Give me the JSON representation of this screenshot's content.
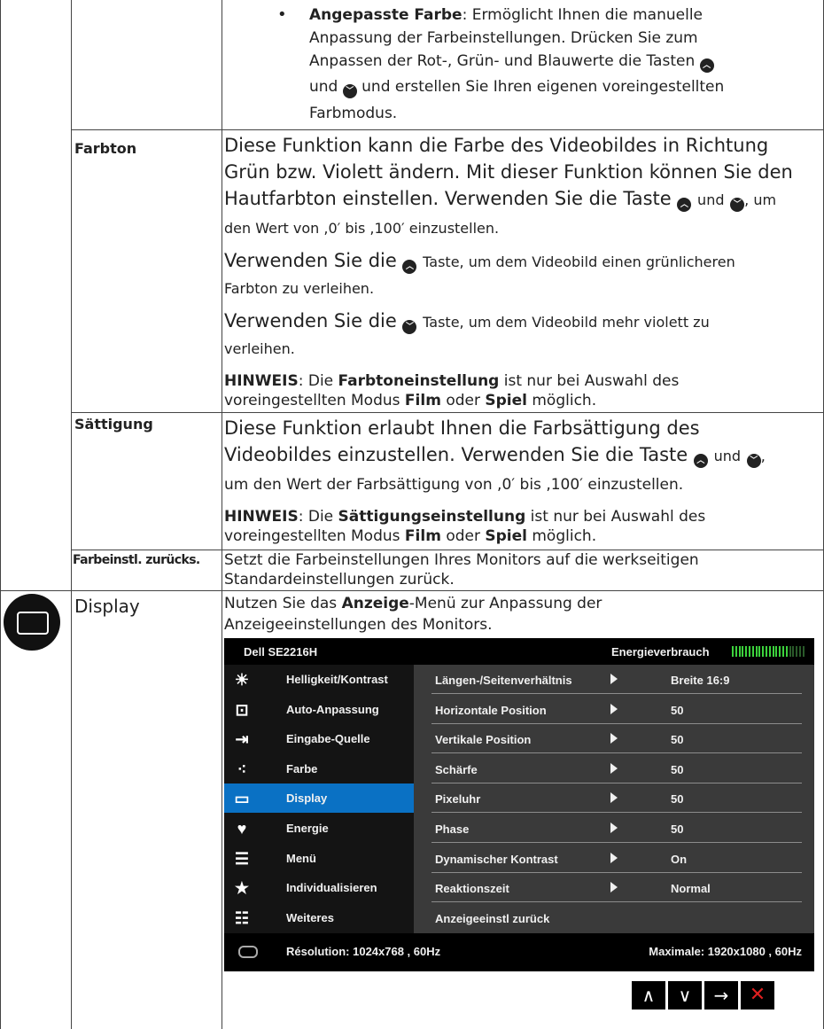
{
  "rows": {
    "row1": {
      "bullet_title": "Angepasste Farbe",
      "bullet_text_1": ": Ermöglicht Ihnen die manuelle",
      "bullet_text_2": "Anpassung der Farbeinstellungen. Drücken Sie zum",
      "bullet_text_3": "Anpassen der Rot-, Grün- und Blauwerte die Tasten",
      "bullet_text_4a": "und",
      "bullet_text_4b": "und erstellen Sie Ihren eigenen voreingestellten",
      "bullet_text_5": "Farbmodus."
    },
    "farbton": {
      "label": "Farbton",
      "p1_l1": "Diese Funktion kann die Farbe des Videobildes in Richtung",
      "p1_l2": "Grün bzw. Violett ändern. Mit dieser Funktion können Sie den",
      "p1_l3a": "Hautfarbton einstellen. Verwenden Sie die Taste",
      "p1_l3b": "und",
      "p1_l3c": ", um",
      "p1_l4": "den Wert von ,0′ bis ,100′ einzustellen.",
      "p2_l1a": "Verwenden Sie die",
      "p2_l1b": "Taste, um dem Videobild einen grünlicheren",
      "p2_l2": "Farbton zu verleihen.",
      "p3_l1a": "Verwenden Sie die",
      "p3_l1b": "Taste, um dem Videobild mehr violett zu",
      "p3_l2": "verleihen.",
      "note_head": "HINWEIS",
      "note_a": ": Die",
      "note_b": "Farbtoneinstellung",
      "note_c": "ist nur bei Auswahl des",
      "note_d": "voreingestellten Modus",
      "note_e": "Film",
      "note_f": "oder",
      "note_g": "Spiel",
      "note_h": "möglich."
    },
    "saettigung": {
      "label": "Sättigung",
      "p1_l1": "Diese Funktion erlaubt Ihnen die Farbsättigung des",
      "p1_l2a": "Videobildes einzustellen. Verwenden Sie die Taste",
      "p1_l2b": "und",
      "p1_l2c": ",",
      "p1_l3": "um den Wert der Farbsättigung von ,0′ bis ,100′ einzustellen.",
      "note_head": "HINWEIS",
      "note_a": ": Die",
      "note_b": "Sättigungseinstellung",
      "note_c": "ist nur bei Auswahl des",
      "note_d": "voreingestellten Modus",
      "note_e": "Film",
      "note_f": "oder",
      "note_g": "Spiel",
      "note_h": "möglich."
    },
    "reset": {
      "label": "Farbeinstl. zurücks.",
      "l1": "Setzt die Farbeinstellungen Ihres Monitors auf die werkseitigen",
      "l2": "Standardeinstellungen zurück."
    },
    "display": {
      "label": "Display",
      "l1a": "Nutzen Sie das",
      "l1b": "Anzeige",
      "l1c": "-Menü zur Anpassung der",
      "l2": "Anzeigeeinstellungen des Monitors."
    }
  },
  "osd": {
    "model": "Dell SE2216H",
    "energy_label": "Energieverbrauch",
    "energy_level": 0.75,
    "menu": [
      {
        "label": "Helligkeit/Kontrast",
        "icon": "brightness-icon"
      },
      {
        "label": "Auto-Anpassung",
        "icon": "auto-adjust-icon"
      },
      {
        "label": "Eingabe-Quelle",
        "icon": "input-source-icon"
      },
      {
        "label": "Farbe",
        "icon": "color-icon"
      },
      {
        "label": "Display",
        "icon": "display-icon"
      },
      {
        "label": "Energie",
        "icon": "energy-icon"
      },
      {
        "label": "Menü",
        "icon": "menu-icon"
      },
      {
        "label": "Individualisieren",
        "icon": "star-icon"
      },
      {
        "label": "Weiteres",
        "icon": "settings-sliders-icon"
      }
    ],
    "selected_menu": "Display",
    "options": [
      {
        "label": "Längen-/Seitenverhältnis",
        "value": "Breite 16:9"
      },
      {
        "label": "Horizontale Position",
        "value": "50"
      },
      {
        "label": "Vertikale Position",
        "value": "50"
      },
      {
        "label": "Schärfe",
        "value": "50"
      },
      {
        "label": "Pixeluhr",
        "value": "50"
      },
      {
        "label": "Phase",
        "value": "50"
      },
      {
        "label": "Dynamischer Kontrast",
        "value": "On"
      },
      {
        "label": "Reaktionszeit",
        "value": "Normal"
      },
      {
        "label": "Anzeigeeinstl zurück",
        "value": ""
      }
    ],
    "resolution": "Résolution: 1024x768 , 60Hz",
    "maximale": "Maximale: 1920x1080 , 60Hz"
  },
  "nav_buttons": [
    {
      "name": "up-arrow-icon",
      "glyph": "∧"
    },
    {
      "name": "down-arrow-icon",
      "glyph": "∨"
    },
    {
      "name": "right-arrow-icon",
      "glyph": "→"
    },
    {
      "name": "close-icon",
      "glyph": "✕"
    }
  ],
  "colors": {
    "osd_highlight": "#0a71c4",
    "close_red": "#e02020",
    "energy_green": "#3cd23c"
  }
}
